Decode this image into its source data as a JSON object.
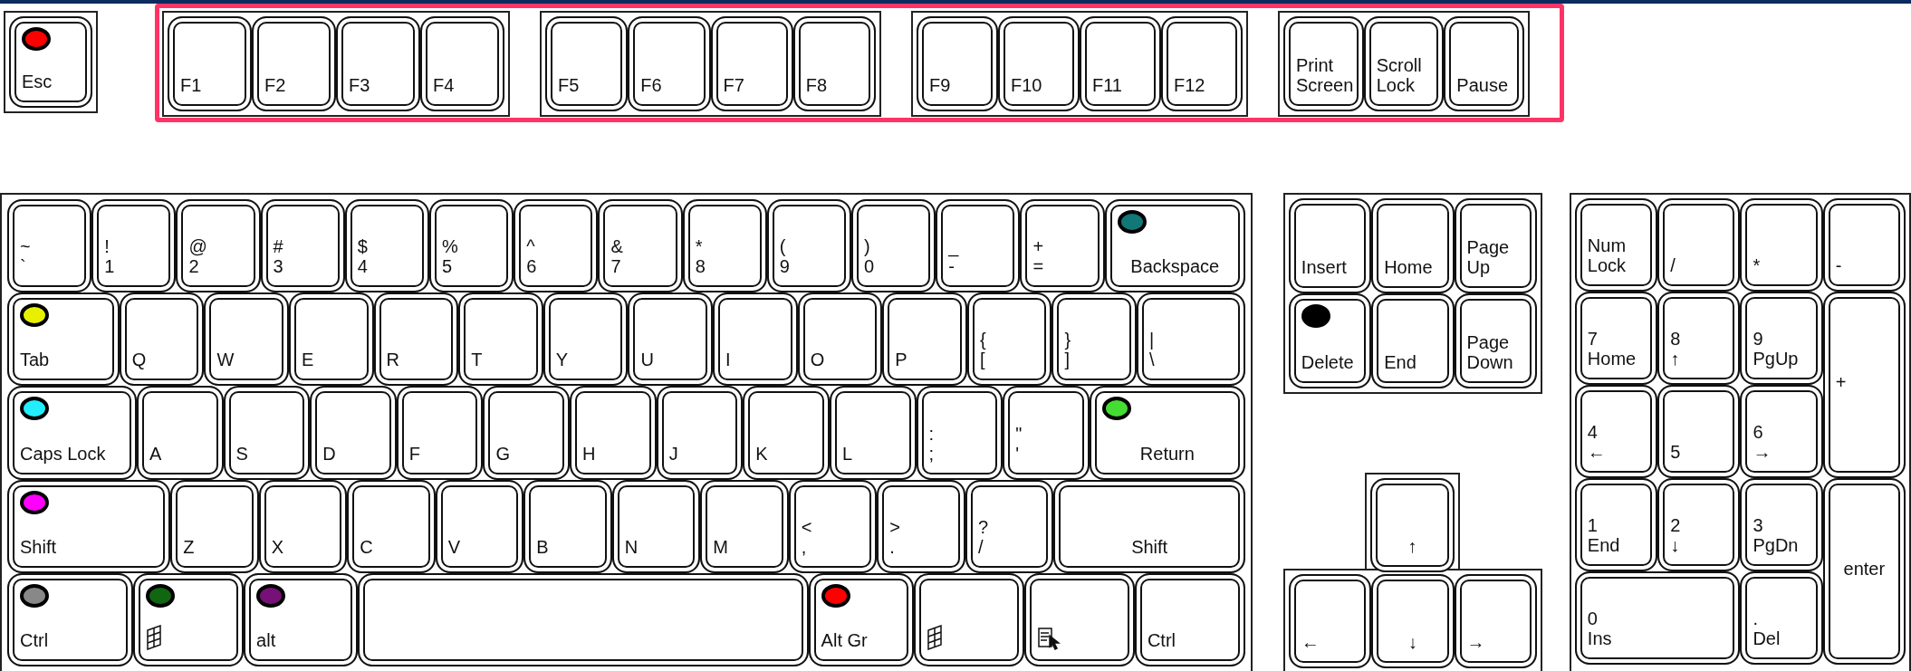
{
  "esc": {
    "legend": [
      "Esc"
    ],
    "color": "#ff0000"
  },
  "function_row": {
    "highlighted": true,
    "groups": [
      [
        {
          "legend": [
            "F1"
          ]
        },
        {
          "legend": [
            "F2"
          ]
        },
        {
          "legend": [
            "F3"
          ]
        },
        {
          "legend": [
            "F4"
          ]
        }
      ],
      [
        {
          "legend": [
            "F5"
          ]
        },
        {
          "legend": [
            "F6"
          ]
        },
        {
          "legend": [
            "F7"
          ]
        },
        {
          "legend": [
            "F8"
          ]
        }
      ],
      [
        {
          "legend": [
            "F9"
          ]
        },
        {
          "legend": [
            "F10"
          ]
        },
        {
          "legend": [
            "F11"
          ]
        },
        {
          "legend": [
            "F12"
          ]
        }
      ],
      [
        {
          "legend": [
            "Print",
            "Screen"
          ]
        },
        {
          "legend": [
            "Scroll",
            "Lock"
          ]
        },
        {
          "legend": [
            "Pause"
          ]
        }
      ]
    ]
  },
  "main": {
    "keys": [
      {
        "kind": "text",
        "legend": [
          "~",
          "`"
        ]
      },
      {
        "kind": "text",
        "legend": [
          "!",
          "1"
        ]
      },
      {
        "kind": "text",
        "legend": [
          "@",
          "2"
        ]
      },
      {
        "kind": "text",
        "legend": [
          "#",
          "3"
        ]
      },
      {
        "kind": "text",
        "legend": [
          "$",
          "4"
        ]
      },
      {
        "kind": "text",
        "legend": [
          "%",
          "5"
        ]
      },
      {
        "kind": "text",
        "legend": [
          "^",
          "6"
        ]
      },
      {
        "kind": "text",
        "legend": [
          "&",
          "7"
        ]
      },
      {
        "kind": "text",
        "legend": [
          "*",
          "8"
        ]
      },
      {
        "kind": "text",
        "legend": [
          "(",
          "9"
        ]
      },
      {
        "kind": "text",
        "legend": [
          ")",
          "0"
        ]
      },
      {
        "kind": "text",
        "legend": [
          "_",
          "-"
        ]
      },
      {
        "kind": "text",
        "legend": [
          "+",
          "="
        ]
      },
      {
        "kind": "text",
        "legend": [
          "Backspace"
        ],
        "color": "#117777"
      },
      {
        "kind": "text",
        "legend": [
          "Tab"
        ],
        "color": "#e8f000"
      },
      {
        "kind": "text",
        "legend": [
          "Q"
        ]
      },
      {
        "kind": "text",
        "legend": [
          "W"
        ]
      },
      {
        "kind": "text",
        "legend": [
          "E"
        ]
      },
      {
        "kind": "text",
        "legend": [
          "R"
        ]
      },
      {
        "kind": "text",
        "legend": [
          "T"
        ]
      },
      {
        "kind": "text",
        "legend": [
          "Y"
        ]
      },
      {
        "kind": "text",
        "legend": [
          "U"
        ]
      },
      {
        "kind": "text",
        "legend": [
          "I"
        ]
      },
      {
        "kind": "text",
        "legend": [
          "O"
        ]
      },
      {
        "kind": "text",
        "legend": [
          "P"
        ]
      },
      {
        "kind": "text",
        "legend": [
          "{",
          "["
        ]
      },
      {
        "kind": "text",
        "legend": [
          "}",
          "]"
        ]
      },
      {
        "kind": "text",
        "legend": [
          "|",
          "\\"
        ]
      },
      {
        "kind": "text",
        "legend": [
          "Caps Lock"
        ],
        "color": "#22eeff"
      },
      {
        "kind": "text",
        "legend": [
          "A"
        ]
      },
      {
        "kind": "text",
        "legend": [
          "S"
        ]
      },
      {
        "kind": "text",
        "legend": [
          "D"
        ]
      },
      {
        "kind": "text",
        "legend": [
          "F"
        ]
      },
      {
        "kind": "text",
        "legend": [
          "G"
        ]
      },
      {
        "kind": "text",
        "legend": [
          "H"
        ]
      },
      {
        "kind": "text",
        "legend": [
          "J"
        ]
      },
      {
        "kind": "text",
        "legend": [
          "K"
        ]
      },
      {
        "kind": "text",
        "legend": [
          "L"
        ]
      },
      {
        "kind": "text",
        "legend": [
          ":",
          ";"
        ]
      },
      {
        "kind": "text",
        "legend": [
          "\"",
          "'"
        ]
      },
      {
        "kind": "text",
        "legend": [
          "Return"
        ],
        "color": "#44dd33"
      },
      {
        "kind": "text",
        "legend": [
          "Shift"
        ],
        "color": "#ff00ff"
      },
      {
        "kind": "text",
        "legend": [
          "Z"
        ]
      },
      {
        "kind": "text",
        "legend": [
          "X"
        ]
      },
      {
        "kind": "text",
        "legend": [
          "C"
        ]
      },
      {
        "kind": "text",
        "legend": [
          "V"
        ]
      },
      {
        "kind": "text",
        "legend": [
          "B"
        ]
      },
      {
        "kind": "text",
        "legend": [
          "N"
        ]
      },
      {
        "kind": "text",
        "legend": [
          "M"
        ]
      },
      {
        "kind": "text",
        "legend": [
          "<",
          ","
        ]
      },
      {
        "kind": "text",
        "legend": [
          ">",
          "."
        ]
      },
      {
        "kind": "text",
        "legend": [
          "?",
          "/"
        ]
      },
      {
        "kind": "text",
        "legend": [
          "Shift"
        ]
      },
      {
        "kind": "text",
        "legend": [
          "Ctrl"
        ],
        "color": "#888888"
      },
      {
        "kind": "window",
        "color": "#116611"
      },
      {
        "kind": "text",
        "legend": [
          "alt"
        ],
        "color": "#771177"
      },
      {
        "kind": "blank"
      },
      {
        "kind": "text",
        "legend": [
          "Alt Gr"
        ],
        "color": "#ff0000"
      },
      {
        "kind": "window"
      },
      {
        "kind": "menu"
      },
      {
        "kind": "text",
        "legend": [
          "Ctrl"
        ]
      }
    ]
  },
  "nav": {
    "keys": [
      {
        "legend": [
          "Insert"
        ]
      },
      {
        "legend": [
          "Home"
        ]
      },
      {
        "legend": [
          "Page",
          "Up"
        ]
      },
      {
        "legend": [
          "Delete"
        ],
        "color": "#000000"
      },
      {
        "legend": [
          "End"
        ]
      },
      {
        "legend": [
          "Page",
          "Down"
        ]
      }
    ]
  },
  "arrows": {
    "keys": [
      {
        "legend": [
          "↑"
        ]
      },
      {
        "legend": [
          "←"
        ]
      },
      {
        "legend": [
          "↓"
        ]
      },
      {
        "legend": [
          "→"
        ]
      }
    ]
  },
  "numpad": {
    "keys": [
      {
        "legend": [
          "Num",
          "Lock"
        ]
      },
      {
        "legend": [
          "/"
        ]
      },
      {
        "legend": [
          "*"
        ]
      },
      {
        "legend": [
          "-"
        ]
      },
      {
        "legend": [
          "7",
          "Home"
        ]
      },
      {
        "legend": [
          "8",
          "↑"
        ]
      },
      {
        "legend": [
          "9",
          "PgUp"
        ]
      },
      {
        "legend": [
          "+"
        ]
      },
      {
        "legend": [
          "4",
          "←"
        ]
      },
      {
        "legend": [
          "5"
        ]
      },
      {
        "legend": [
          "6",
          "→"
        ]
      },
      {
        "legend": [
          "1",
          "End"
        ]
      },
      {
        "legend": [
          "2",
          "↓"
        ]
      },
      {
        "legend": [
          "3",
          "PgDn"
        ]
      },
      {
        "legend": [
          "enter"
        ]
      },
      {
        "legend": [
          "0",
          "Ins"
        ]
      },
      {
        "legend": [
          ".",
          "Del"
        ]
      }
    ]
  }
}
